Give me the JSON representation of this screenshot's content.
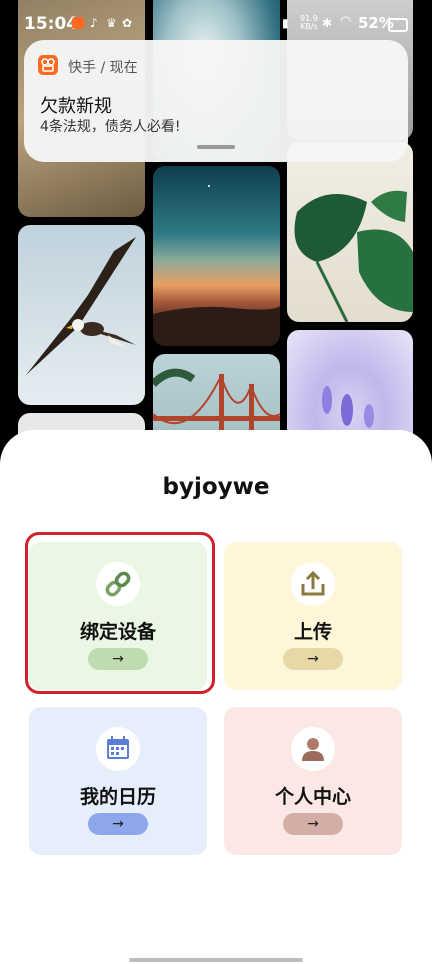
{
  "status_bar": {
    "time": "15:04",
    "network_speed_value": "91.9",
    "network_speed_unit": "KB/s",
    "battery": "52%"
  },
  "notification": {
    "app_line": "快手 / 现在",
    "title": "欠款新规",
    "body": "4条法规，债务人必看!"
  },
  "app": {
    "brand": "byjoywe"
  },
  "cards": [
    {
      "label": "绑定设备",
      "icon": "link-icon",
      "accent": "#bfdcb1"
    },
    {
      "label": "上传",
      "icon": "upload-icon",
      "accent": "#e6d9a7"
    },
    {
      "label": "我的日历",
      "icon": "calendar-icon",
      "accent": "#8ea6ec"
    },
    {
      "label": "个人中心",
      "icon": "user-icon",
      "accent": "#d3aea6"
    }
  ],
  "arrow_glyph": "→",
  "highlight_color": "#d0222c"
}
